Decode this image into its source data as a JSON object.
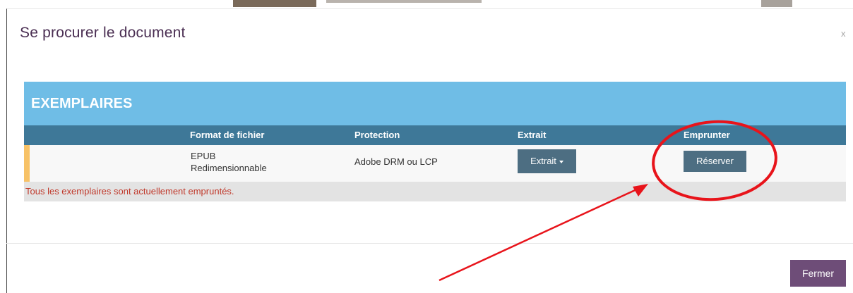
{
  "modal": {
    "title": "Se procurer le document",
    "close_label": "x",
    "close_button_label": "Fermer"
  },
  "section": {
    "heading": "EXEMPLAIRES",
    "columns": {
      "format": "Format de fichier",
      "protection": "Protection",
      "extrait": "Extrait",
      "emprunter": "Emprunter"
    },
    "rows": [
      {
        "format_line1": "EPUB",
        "format_line2": "Redimensionnable",
        "protection": "Adobe DRM ou LCP",
        "extrait_button": "Extrait",
        "emprunter_button": "Réserver"
      }
    ],
    "notice": "Tous les exemplaires sont actuellement empruntés."
  },
  "colors": {
    "section_header": "#6fbde6",
    "column_header": "#3e7898",
    "button": "#4d6e82",
    "close_button": "#6e4d78",
    "accent": "#f7c267",
    "notice_text": "#c0392b",
    "annotation": "#e8141b"
  },
  "annotations": [
    "red-circle-around-reserver",
    "red-arrow-pointing-to-reserver"
  ]
}
